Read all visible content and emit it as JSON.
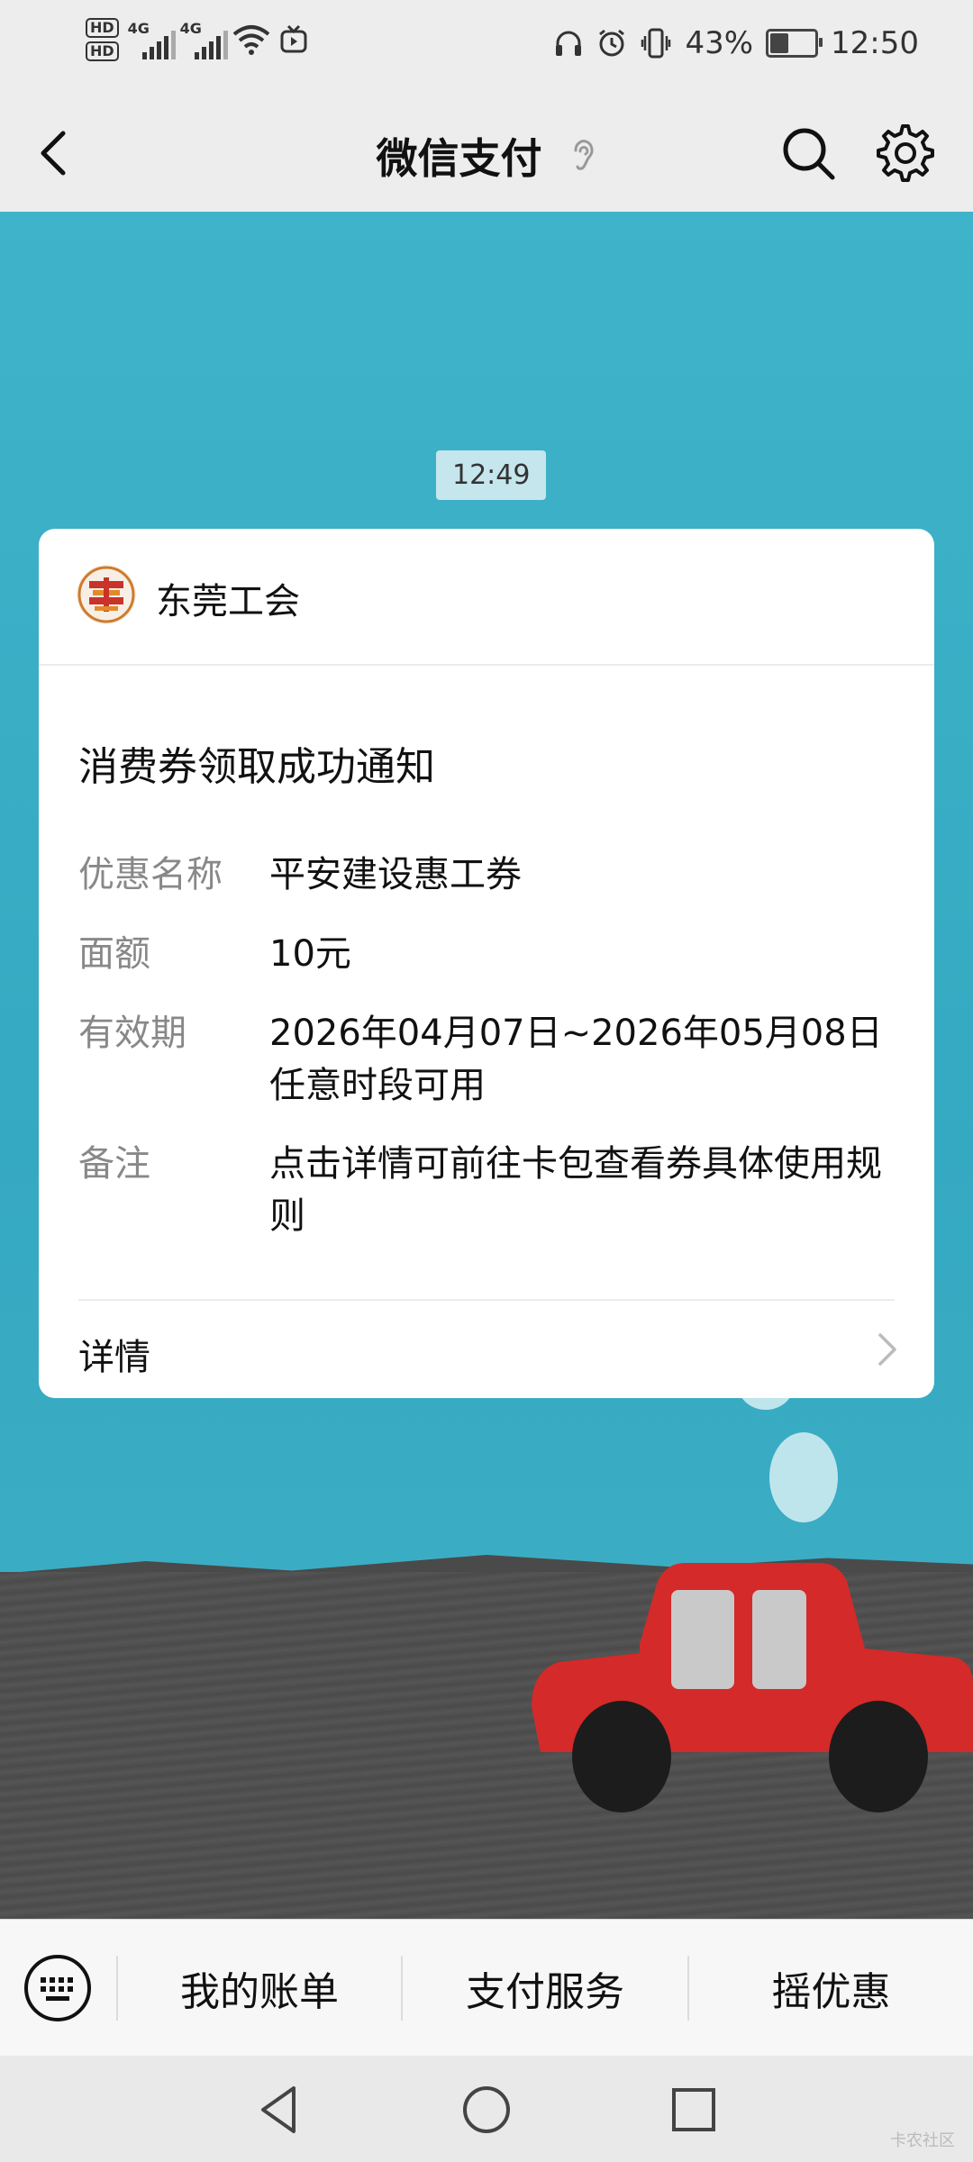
{
  "status_bar": {
    "sim1": "HD",
    "sim2": "HD",
    "net1": "4G",
    "net2": "4G",
    "battery_text": "43%",
    "battery_level": 0.43,
    "time": "12:50"
  },
  "nav": {
    "title": "微信支付"
  },
  "chat": {
    "timestamp": "12:49"
  },
  "card": {
    "brand_name": "东莞工会",
    "title": "消费券领取成功通知",
    "fields": [
      {
        "label": "优惠名称",
        "value": "平安建设惠工券"
      },
      {
        "label": "面额",
        "value": "10元"
      },
      {
        "label": "有效期",
        "value": "2026年04月07日~2026年05月08日任意时段可用"
      },
      {
        "label": "备注",
        "value": "点击详情可前往卡包查看券具体使用规则"
      }
    ],
    "detail_label": "详情"
  },
  "menu": {
    "items": [
      "我的账单",
      "支付服务",
      "摇优惠"
    ]
  },
  "watermark": "卡农社区",
  "colors": {
    "chat_bg": "#3fb3c9",
    "card_bg": "#ffffff",
    "label_gray": "#888888",
    "car_red": "#d42a2a"
  }
}
